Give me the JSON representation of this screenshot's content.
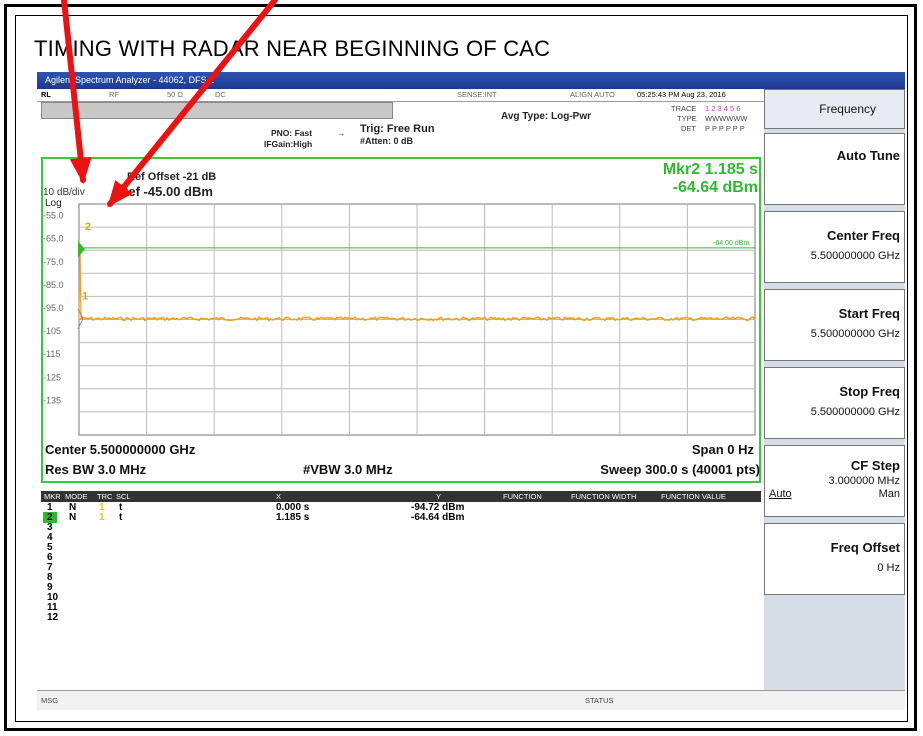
{
  "heading": "TIMING WITH RADAR NEAR BEGINNING OF CAC",
  "window": {
    "title": "Agilent Spectrum Analyzer - 44062, DFS 1"
  },
  "top_bar": {
    "mode": "RL",
    "rf": "RF",
    "ohm": "50 Ω",
    "dc": "DC",
    "sense": "SENSE:INT",
    "align": "ALIGN AUTO",
    "datetime": "05:25:43 PM Aug 23, 2016"
  },
  "settings": {
    "pno": "PNO: Fast",
    "ifgain": "IFGain:High",
    "trig": "Trig: Free Run",
    "atten": "#Atten: 0 dB",
    "avg_type": "Avg Type: Log-Pwr",
    "trace_label": "TRACE",
    "trace_vals": "1 2 3 4 5 6",
    "type_label": "TYPE",
    "type_vals": "WWWWWW",
    "det_label": "DET",
    "det_vals": "P P P P P P"
  },
  "display": {
    "ref_offset": "Ref Offset -21 dB",
    "scale": "10 dB/div",
    "ref_level": "Ref -45.00 dBm",
    "log": "Log",
    "marker_readout_label": "Mkr2 1.185 s",
    "marker_readout_value": "-64.64 dBm",
    "threshold_label": "-64.00 dBm",
    "y_ticks": [
      "-55.0",
      "-65.0",
      "-75.0",
      "-85.0",
      "-95.0",
      "-105",
      "-115",
      "-125",
      "-135"
    ],
    "marker1": "1",
    "marker2": "2"
  },
  "chart_data": {
    "type": "line",
    "title": "",
    "xlabel": "",
    "ylabel": "",
    "ylim": [
      -145,
      -45
    ],
    "x_range_s": [
      0,
      300
    ],
    "series": [
      {
        "values_dBm_level": -94.7
      }
    ],
    "threshold_dBm": -64.0
  },
  "footer": {
    "center": "Center 5.500000000 GHz",
    "span": "Span 0 Hz",
    "res_bw": "Res BW 3.0 MHz",
    "vbw": "#VBW 3.0 MHz",
    "sweep": "Sweep  300.0 s (40001 pts)"
  },
  "marker_table": {
    "headers": [
      "MKR",
      "MODE",
      "TRC",
      "SCL",
      "X",
      "Y",
      "FUNCTION",
      "FUNCTION WIDTH",
      "FUNCTION VALUE"
    ],
    "rows": [
      {
        "n": "1",
        "mode": "N",
        "trc": "1",
        "scl": "t",
        "x": "0.000 s",
        "y": "-94.72 dBm"
      },
      {
        "n": "2",
        "mode": "N",
        "trc": "1",
        "scl": "t",
        "x": "1.185 s",
        "y": "-64.64 dBm"
      },
      {
        "n": "3"
      },
      {
        "n": "4"
      },
      {
        "n": "5"
      },
      {
        "n": "6"
      },
      {
        "n": "7"
      },
      {
        "n": "8"
      },
      {
        "n": "9"
      },
      {
        "n": "10"
      },
      {
        "n": "11"
      },
      {
        "n": "12"
      }
    ]
  },
  "status": {
    "msg": "MSG",
    "status": "STATUS"
  },
  "softkeys": {
    "title": "Frequency",
    "auto_tune": "Auto Tune",
    "center_freq": "Center Freq",
    "center_freq_val": "5.500000000 GHz",
    "start_freq": "Start Freq",
    "start_freq_val": "5.500000000 GHz",
    "stop_freq": "Stop Freq",
    "stop_freq_val": "5.500000000 GHz",
    "cf_step": "CF Step",
    "cf_step_val": "3.000000 MHz",
    "cf_auto": "Auto",
    "cf_man": "Man",
    "freq_offset": "Freq Offset",
    "freq_offset_val": "0 Hz"
  },
  "colors": {
    "trace": "#f0a020",
    "grid_border": "#38c838",
    "marker_green": "#2dba2d",
    "arrow": "#ee1111",
    "titlebar": "#1f44a0"
  }
}
